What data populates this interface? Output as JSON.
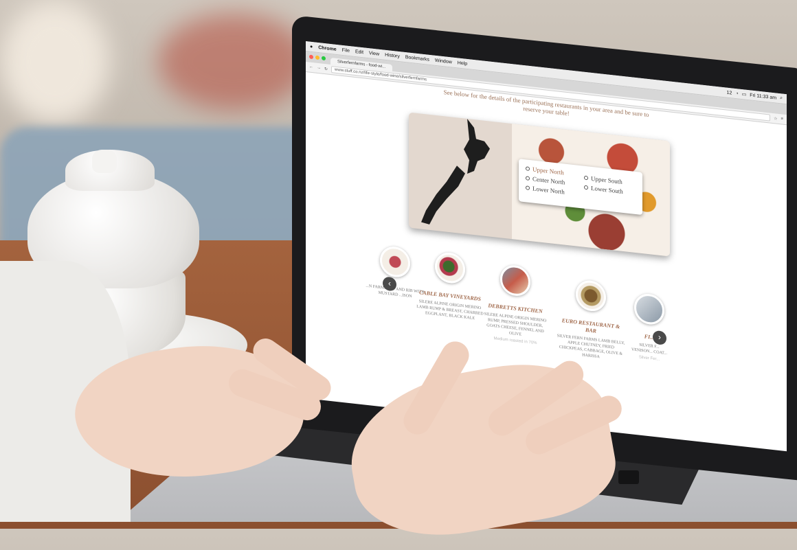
{
  "mac_menu": {
    "app": "Chrome",
    "items": [
      "File",
      "Edit",
      "View",
      "History",
      "Bookmarks",
      "Window",
      "Help"
    ],
    "status_num": "12",
    "clock": "Fri 11:33 am"
  },
  "browser": {
    "tab_title": "Silverfernfarms - food-wi...",
    "url": "www.stuff.co.nz/life-style/food-wine/silverfernfarms"
  },
  "page": {
    "intro_line1": "See below for the details of the participating restaurants in your area and be sure to",
    "intro_line2": "reserve your table!",
    "regions": [
      "Upper North",
      "Center North",
      "Lower North",
      "Upper South",
      "Lower South"
    ],
    "cards": [
      {
        "name": "",
        "desc": "...N FARMS LET AND RIB WITH MUSTARD ...ISON",
        "foot": ""
      },
      {
        "name": "CABLE BAY VINEYARDS",
        "desc": "SILERE ALPINE ORIGIN MERINO LAMB RUMP & BREAST, CHARRED EGGPLANT, BLACK KALE",
        "foot": ""
      },
      {
        "name": "DEBRETTS KITCHEN",
        "desc": "SILERE ALPINE ORIGIN MERINO RUMP, PRESSED SHOULDER, GOATS CHEESE, FENNEL AND OLIVE",
        "foot": "Medium roasted in 70%"
      },
      {
        "name": "EURO RESTAURANT & BAR",
        "desc": "SILVER FERN FARMS LAMB BELLY, APPLE CHUTNEY, FRIED CHICKPEAS, CABBAGE, OLIVE & HARISSA",
        "foot": ""
      },
      {
        "name": "FI...",
        "desc": "SILVER F... VENISON... COAT...",
        "foot": "Silver Fer..."
      }
    ],
    "prev_glyph": "‹",
    "next_glyph": "›"
  }
}
